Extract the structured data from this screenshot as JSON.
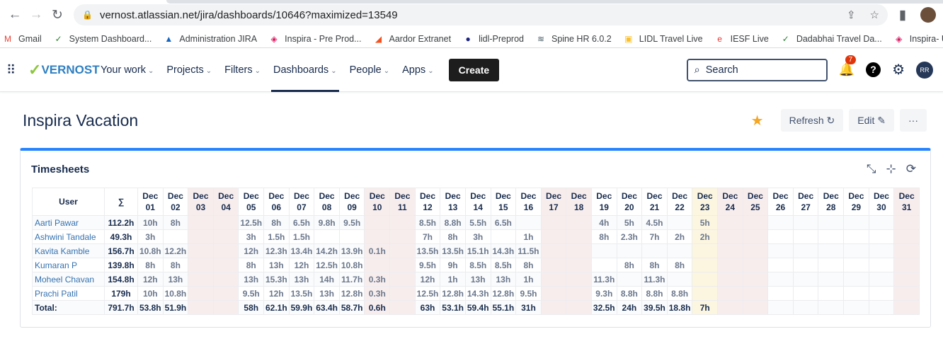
{
  "browser": {
    "url": "vernost.atlassian.net/jira/dashboards/10646?maximized=13549",
    "bookmarks": [
      "Gmail",
      "System Dashboard...",
      "Administration JIRA",
      "Inspira - Pre Prod...",
      "Aardor Extranet",
      "lidl-Preprod",
      "Spine HR 6.0.2",
      "LIDL Travel Live",
      "IESF Live",
      "Dadabhai Travel Da...",
      "Inspira- UAT"
    ]
  },
  "nav": {
    "logo": "VERNOST",
    "items": [
      "Your work",
      "Projects",
      "Filters",
      "Dashboards",
      "People",
      "Apps"
    ],
    "create": "Create",
    "search_placeholder": "Search",
    "notifications": "7",
    "avatar": "RR"
  },
  "page": {
    "title": "Inspira Vacation",
    "refresh": "Refresh ↻",
    "edit": "Edit ✎",
    "more": "···"
  },
  "gadget": {
    "title": "Timesheets",
    "header": {
      "user": "User",
      "sum": "∑",
      "month": "Dec"
    },
    "days": [
      "01",
      "02",
      "03",
      "04",
      "05",
      "06",
      "07",
      "08",
      "09",
      "10",
      "11",
      "12",
      "13",
      "14",
      "15",
      "16",
      "17",
      "18",
      "19",
      "20",
      "21",
      "22",
      "23",
      "24",
      "25",
      "26",
      "27",
      "28",
      "29",
      "30",
      "31"
    ],
    "weekend_days": [
      "03",
      "04",
      "10",
      "11",
      "17",
      "18",
      "24",
      "25",
      "31"
    ],
    "today": "23",
    "rows": [
      {
        "user": "Aarti Pawar",
        "sum": "112.2h",
        "hours": [
          "10h",
          "8h",
          "",
          "",
          "12.5h",
          "8h",
          "6.5h",
          "9.8h",
          "9.5h",
          "",
          "",
          "8.5h",
          "8.8h",
          "5.5h",
          "6.5h",
          "",
          "",
          "",
          "4h",
          "5h",
          "4.5h",
          "",
          "5h",
          "",
          "",
          "",
          "",
          "",
          "",
          "",
          ""
        ]
      },
      {
        "user": "Ashwini Tandale",
        "sum": "49.3h",
        "hours": [
          "3h",
          "",
          "",
          "",
          "3h",
          "1.5h",
          "1.5h",
          "",
          "",
          "",
          "",
          "7h",
          "8h",
          "3h",
          "",
          "1h",
          "",
          "",
          "8h",
          "2.3h",
          "7h",
          "2h",
          "2h",
          "",
          "",
          "",
          "",
          "",
          "",
          "",
          ""
        ]
      },
      {
        "user": "Kavita Kamble",
        "sum": "156.7h",
        "hours": [
          "10.8h",
          "12.2h",
          "",
          "",
          "12h",
          "12.3h",
          "13.4h",
          "14.2h",
          "13.9h",
          "0.1h",
          "",
          "13.5h",
          "13.5h",
          "15.1h",
          "14.3h",
          "11.5h",
          "",
          "",
          "",
          "",
          "",
          "",
          "",
          "",
          "",
          "",
          "",
          "",
          "",
          "",
          ""
        ]
      },
      {
        "user": "Kumaran P",
        "sum": "139.8h",
        "hours": [
          "8h",
          "8h",
          "",
          "",
          "8h",
          "13h",
          "12h",
          "12.5h",
          "10.8h",
          "",
          "",
          "9.5h",
          "9h",
          "8.5h",
          "8.5h",
          "8h",
          "",
          "",
          "",
          "8h",
          "8h",
          "8h",
          "",
          "",
          "",
          "",
          "",
          "",
          "",
          "",
          ""
        ]
      },
      {
        "user": "Moheel Chavan",
        "sum": "154.8h",
        "hours": [
          "12h",
          "13h",
          "",
          "",
          "13h",
          "15.3h",
          "13h",
          "14h",
          "11.7h",
          "0.3h",
          "",
          "12h",
          "1h",
          "13h",
          "13h",
          "1h",
          "",
          "",
          "11.3h",
          "",
          "11.3h",
          "",
          "",
          "",
          "",
          "",
          "",
          "",
          "",
          "",
          ""
        ]
      },
      {
        "user": "Prachi Patil",
        "sum": "179h",
        "hours": [
          "10h",
          "10.8h",
          "",
          "",
          "9.5h",
          "12h",
          "13.5h",
          "13h",
          "12.8h",
          "0.3h",
          "",
          "12.5h",
          "12.8h",
          "14.3h",
          "12.8h",
          "9.5h",
          "",
          "",
          "9.3h",
          "8.8h",
          "8.8h",
          "8.8h",
          "",
          "",
          "",
          "",
          "",
          "",
          "",
          "",
          ""
        ]
      }
    ],
    "total": {
      "label": "Total:",
      "sum": "791.7h",
      "hours": [
        "53.8h",
        "51.9h",
        "",
        "",
        "58h",
        "62.1h",
        "59.9h",
        "63.4h",
        "58.7h",
        "0.6h",
        "",
        "63h",
        "53.1h",
        "59.4h",
        "55.1h",
        "31h",
        "",
        "",
        "32.5h",
        "24h",
        "39.5h",
        "18.8h",
        "7h",
        "",
        "",
        "",
        "",
        "",
        "",
        "",
        ""
      ]
    }
  }
}
